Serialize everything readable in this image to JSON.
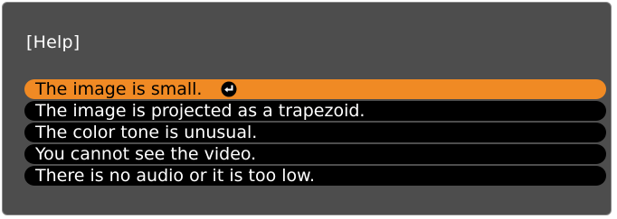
{
  "dialog": {
    "title": "[Help]"
  },
  "menu": {
    "items": [
      {
        "label": "The image is small.",
        "selected": true,
        "icon": "enter-icon"
      },
      {
        "label": "The image is projected as a trapezoid.",
        "selected": false
      },
      {
        "label": "The color tone is unusual.",
        "selected": false
      },
      {
        "label": "You cannot see the video.",
        "selected": false
      },
      {
        "label": "There is no audio or it is too low.",
        "selected": false
      }
    ]
  },
  "colors": {
    "panel_background": "#4d4d4d",
    "item_background": "#000000",
    "selected_background": "#f08a24",
    "text": "#ffffff",
    "selected_text": "#000000"
  }
}
